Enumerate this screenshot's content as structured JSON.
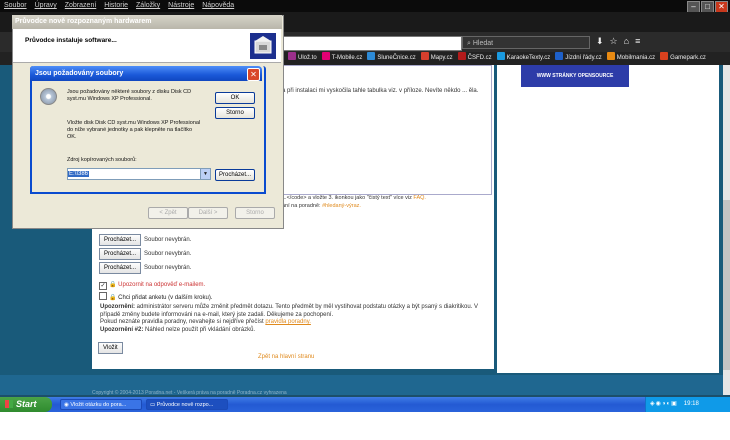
{
  "browser": {
    "menu": [
      "Soubor",
      "Úpravy",
      "Zobrazení",
      "Historie",
      "Záložky",
      "Nástroje",
      "Nápověda"
    ],
    "url_partial": "",
    "search_placeholder": "Hledat",
    "bookmarks": [
      {
        "label": "Ulož.to",
        "color": "#9c2f8c"
      },
      {
        "label": "T-Mobile.cz",
        "color": "#e20074"
      },
      {
        "label": "SluneČnice.cz",
        "color": "#2d8ad6"
      },
      {
        "label": "Mapy.cz",
        "color": "#d63f2d"
      },
      {
        "label": "ČSFD.cz",
        "color": "#b31b1b"
      },
      {
        "label": "KaraokeTexty.cz",
        "color": "#1a9ae0"
      },
      {
        "label": "Jízdní řády.cz",
        "color": "#1e60c9"
      },
      {
        "label": "Mobilmania.cz",
        "color": "#e88a12"
      },
      {
        "label": "Gamepark.cz",
        "color": "#d9411e"
      }
    ]
  },
  "page": {
    "ad_text": "WWW STRÁNKY OPENSOURCE",
    "body_text": "a při instalaci mi vyskočila tahle tabulka viz. v příloze. Nevíte někdo ... ěla.",
    "help_text_1": "...</code> a vložte 3. ikonkou jako \"čistý text\" více viz",
    "help_link": "FAQ.",
    "help_text_2": "ání na poradně:",
    "help_hash": "#hledaný-výraz.",
    "browse_label": "Procházet...",
    "file_status": "Soubor nevybrán.",
    "notify_label": "Upozornit na odpověď e-mailem.",
    "poll_label": "Chci přidat anketu (v dalším kroku).",
    "warn_title": "Upozornění:",
    "warn_text": "administrátor serveru může změnit předmět dotazu. Tento předmět by měl vystihovat podstatu otázky a být psaný s diakritikou. V případě změny budete informováni na e-mail, který jste zadali. Děkujeme za pochopení.",
    "rules_text": "Pokud neznáte pravidla poradny, nevahejte si nejdříve přečíst",
    "rules_link": "pravidla poradny.",
    "warn2_title": "Upozornění #2:",
    "warn2_text": "Náhled nelze použít při vkládání obrázků.",
    "submit_label": "Vložit",
    "back_link": "Zpět na hlavní stranu",
    "footer_text": "Copyright © 2004-2013 Poradna.net - Veškerá práva na poradně Poradna.cz vyhrazena"
  },
  "wizard": {
    "title": "Průvodce nově rozpoznaným hardwarem",
    "heading": "Průvodce instaluje software...",
    "back_label": "< Zpět",
    "next_label": "Další >",
    "cancel_label": "Storno"
  },
  "dialog": {
    "title": "Jsou požadovány soubory",
    "text1_line1": "Jsou požadovány některé soubory z disku Disk CD",
    "text1_line2": "syst.mu Windows XP Professional.",
    "text2_line1": "Vložte disk Disk CD syst.mu Windows XP Professional",
    "text2_line2": "do níže vybrané jednotky a pak klepněte na tlačítko",
    "text2_line3": "OK.",
    "source_label": "Zdroj kopírovaných souborů:",
    "source_value": "E:\\I386",
    "ok_label": "OK",
    "cancel_label": "Storno",
    "browse_label": "Procházet..."
  },
  "taskbar": {
    "start_label": "Start",
    "tasks": [
      {
        "label": "Vložit otázku do pora...",
        "active": false
      },
      {
        "label": "Průvodce nově rozpo...",
        "active": true
      }
    ],
    "clock": "19:18"
  }
}
